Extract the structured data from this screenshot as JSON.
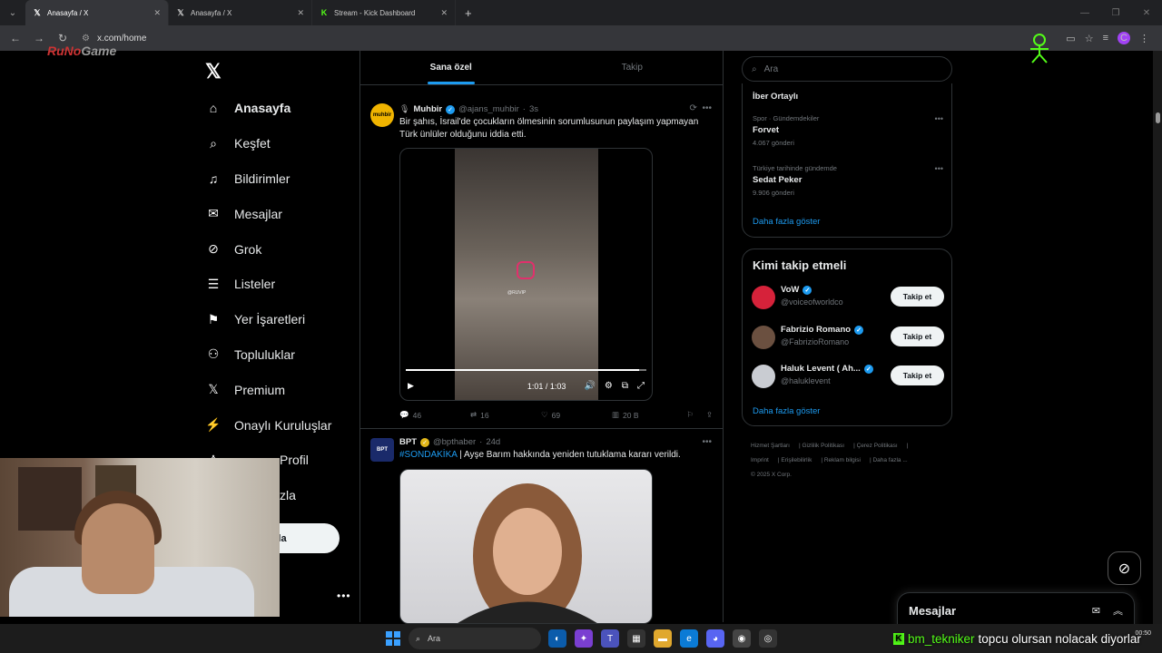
{
  "browser": {
    "tabs": [
      {
        "title": "Anasayfa / X",
        "favicon": "x-icon",
        "active": true
      },
      {
        "title": "Anasayfa / X",
        "favicon": "x-icon",
        "active": false
      },
      {
        "title": "Stream - Kick Dashboard",
        "favicon": "kick-icon",
        "active": false
      }
    ],
    "url": "x.com/home",
    "profile_initial": "C"
  },
  "watermark": {
    "text_a": "RuNo",
    "text_b": "Game"
  },
  "sidebar": {
    "items": [
      {
        "label": "Anasayfa",
        "icon": "home-icon",
        "glyph": "⌂"
      },
      {
        "label": "Keşfet",
        "icon": "search-icon",
        "glyph": "⌕"
      },
      {
        "label": "Bildirimler",
        "icon": "bell-icon",
        "glyph": "♫"
      },
      {
        "label": "Mesajlar",
        "icon": "mail-icon",
        "glyph": "✉"
      },
      {
        "label": "Grok",
        "icon": "grok-icon",
        "glyph": "⊘"
      },
      {
        "label": "Listeler",
        "icon": "list-icon",
        "glyph": "☰"
      },
      {
        "label": "Yer İşaretleri",
        "icon": "bookmark-icon",
        "glyph": "⚑"
      },
      {
        "label": "Topluluklar",
        "icon": "communities-icon",
        "glyph": "⚇"
      },
      {
        "label": "Premium",
        "icon": "x-premium-icon",
        "glyph": "𝕏"
      },
      {
        "label": "Onaylı Kuruluşlar",
        "icon": "lightning-icon",
        "glyph": "⚡"
      },
      {
        "label": "Profil",
        "icon": "profile-icon",
        "glyph": "♙"
      },
      {
        "label": "zla",
        "icon": "more-icon",
        "glyph": ""
      }
    ],
    "post_button": "ayınla"
  },
  "feed": {
    "tabs": [
      "Sana özel",
      "Takip"
    ],
    "tweets": [
      {
        "name": "Muhbir",
        "handle": "@ajans_muhbir",
        "time": "3s",
        "avatar_text": "muhbir",
        "text": "Bir şahıs, İsrail'de çocukların ölmesinin sorumlusunun paylaşım yapmayan Türk ünlüler olduğunu iddia etti.",
        "video": {
          "time": "1:01 / 1:03",
          "watermark": "@RUVIP",
          "progress": 0.97
        },
        "stats": {
          "replies": "46",
          "reposts": "16",
          "likes": "69",
          "views": "20 B"
        }
      },
      {
        "name": "BPT",
        "handle": "@bpthaber",
        "time": "24d",
        "avatar_text": "BPT",
        "hashtag": "#SONDAKİKA",
        "text": " | Ayşe Barım hakkında yeniden tutuklama kararı verildi."
      }
    ]
  },
  "right": {
    "search_placeholder": "Ara",
    "trends": [
      {
        "category": "",
        "title": "İber Ortaylı",
        "count": ""
      },
      {
        "category": "Spor · Gündemdekiler",
        "title": "Forvet",
        "count": "4.067 gönderi"
      },
      {
        "category": "Türkiye tarihinde gündemde",
        "title": "Sedat Peker",
        "count": "9.906 gönderi"
      }
    ],
    "show_more": "Daha fazla göster",
    "who_title": "Kimi takip etmeli",
    "who": [
      {
        "name": "VoW",
        "handle": "@voiceofworldco",
        "follow": "Takip et"
      },
      {
        "name": "Fabrizio Romano",
        "handle": "@FabrizioRomano",
        "follow": "Takip et"
      },
      {
        "name": "Haluk Levent ( Ah...",
        "handle": "@haluklevent",
        "follow": "Takip et"
      }
    ],
    "who_more": "Daha fazla göster",
    "footer": [
      "Hizmet Şartları",
      "Gizlilik Politikası",
      "Çerez Politikası",
      "Imprint",
      "Erişilebilirlik",
      "Reklam bilgisi",
      "Daha fazla ...",
      "© 2025 X Corp."
    ]
  },
  "messages_drawer": {
    "title": "Mesajlar"
  },
  "taskbar": {
    "search": "Ara",
    "time": "00:50"
  },
  "chat_overlay": {
    "user": "bm_tekniker",
    "message": "topcu olursan nolacak diyorlar"
  },
  "colors": {
    "accent": "#1d9bf0",
    "kick": "#53fc18",
    "border": "#2f3336"
  }
}
